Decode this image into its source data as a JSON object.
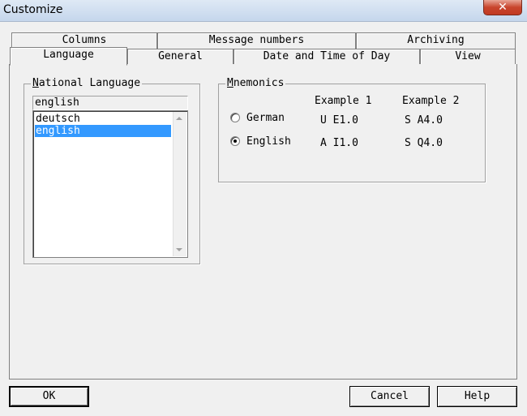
{
  "window": {
    "title": "Customize",
    "close_label": "✕"
  },
  "tabs": {
    "back_row": [
      "Columns",
      "Message numbers",
      "Archiving"
    ],
    "front_row": [
      "Language",
      "General",
      "Date and Time of Day",
      "View"
    ],
    "active": "Language"
  },
  "national_language": {
    "group_label_first": "N",
    "group_label_rest": "ational Language",
    "current_value": "english",
    "items": [
      "deutsch",
      "english"
    ],
    "selected_index": 1
  },
  "mnemonics": {
    "group_label_first": "M",
    "group_label_rest": "nemonics",
    "header_example1": "Example 1",
    "header_example2": "Example 2",
    "options": [
      {
        "label": "German",
        "example1": "U E1.0",
        "example2": "S A4.0",
        "selected": false
      },
      {
        "label": "English",
        "example1": "A I1.0",
        "example2": "S Q4.0",
        "selected": true
      }
    ]
  },
  "buttons": {
    "ok": "OK",
    "cancel": "Cancel",
    "help": "Help"
  },
  "colors": {
    "selection": "#3399ff",
    "dialog_bg": "#f0f0f0",
    "close_red": "#c8452d"
  }
}
